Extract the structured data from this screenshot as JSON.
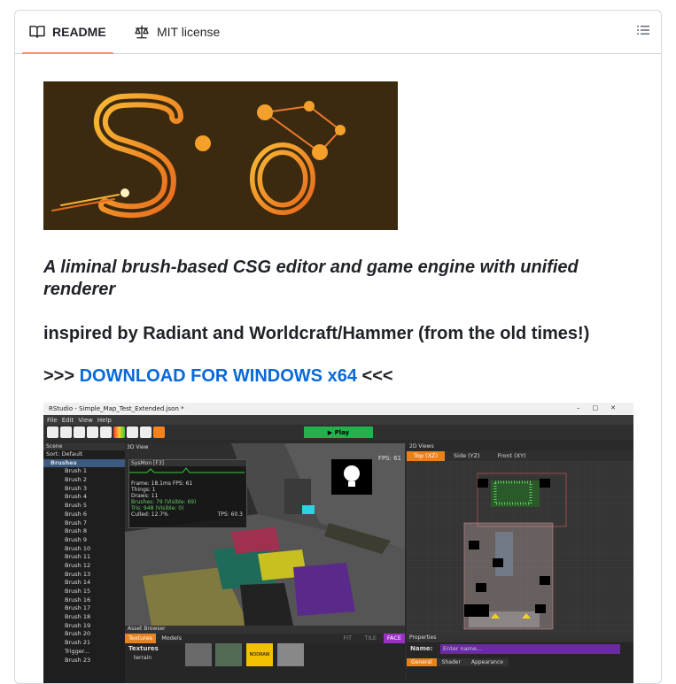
{
  "tabs": {
    "readme": "README",
    "license": "MIT license"
  },
  "headings": {
    "tagline": "A liminal brush-based CSG editor and game engine with unified renderer",
    "inspired": "inspired by Radiant and Worldcraft/Hammer (from the old times!)",
    "download_prefix": ">>> ",
    "download_link": "DOWNLOAD FOR WINDOWS x64",
    "download_suffix": " <<<"
  },
  "colors": {
    "tab_underline": "#fd8c73",
    "link": "#0969da",
    "logo_bg": "#3b2a10"
  },
  "screenshot": {
    "window_title": "RStudio - Simple_Map_Test_Extended.json *",
    "menu": [
      "File",
      "Edit",
      "View",
      "Help"
    ],
    "play_label": "Play",
    "scene_header": "Scene",
    "sort": "Sort: Default",
    "brushes_header": "Brushes",
    "brushes": [
      "Brush 1",
      "Brush 2",
      "Brush 3",
      "Brush 4",
      "Brush 5",
      "Brush 6",
      "Brush 7",
      "Brush 8",
      "Brush 9",
      "Brush 10",
      "Brush 11",
      "Brush 12",
      "Brush 13",
      "Brush 14",
      "Brush 15",
      "Brush 16",
      "Brush 17",
      "Brush 18",
      "Brush 19",
      "Brush 20",
      "Brush 21",
      "Trigger...",
      "Brush 23"
    ],
    "view3d_title": "3D View",
    "fps": "FPS: 61",
    "sysmon_title": "SysMon [F3]",
    "frame": "Frame: 18.1ms  FPS: 61",
    "stats": [
      "Things:  1",
      "Draws:  11",
      "Brushes:  79 (Visible: 69)",
      "Tris:  948 (Visible: 0)"
    ],
    "culled": "Culled: 12.7%",
    "tps": "TPS: 60.3",
    "views2d_title": "2D Views",
    "view_tabs": [
      "Top (XZ)",
      "Side (YZ)",
      "Front (XY)"
    ],
    "asset_browser": "Asset Browser",
    "asset_tabs": [
      "Textures",
      "Models"
    ],
    "asset_modes": [
      "FIT",
      "TILE",
      "FACE"
    ],
    "textures_label": "Textures",
    "terrain_label": "terrain",
    "nodraw": "NODRAW",
    "properties": "Properties",
    "name_label": "Name:",
    "name_placeholder": "Enter name...",
    "prop_tabs": [
      "General",
      "Shader",
      "Appearance"
    ]
  }
}
